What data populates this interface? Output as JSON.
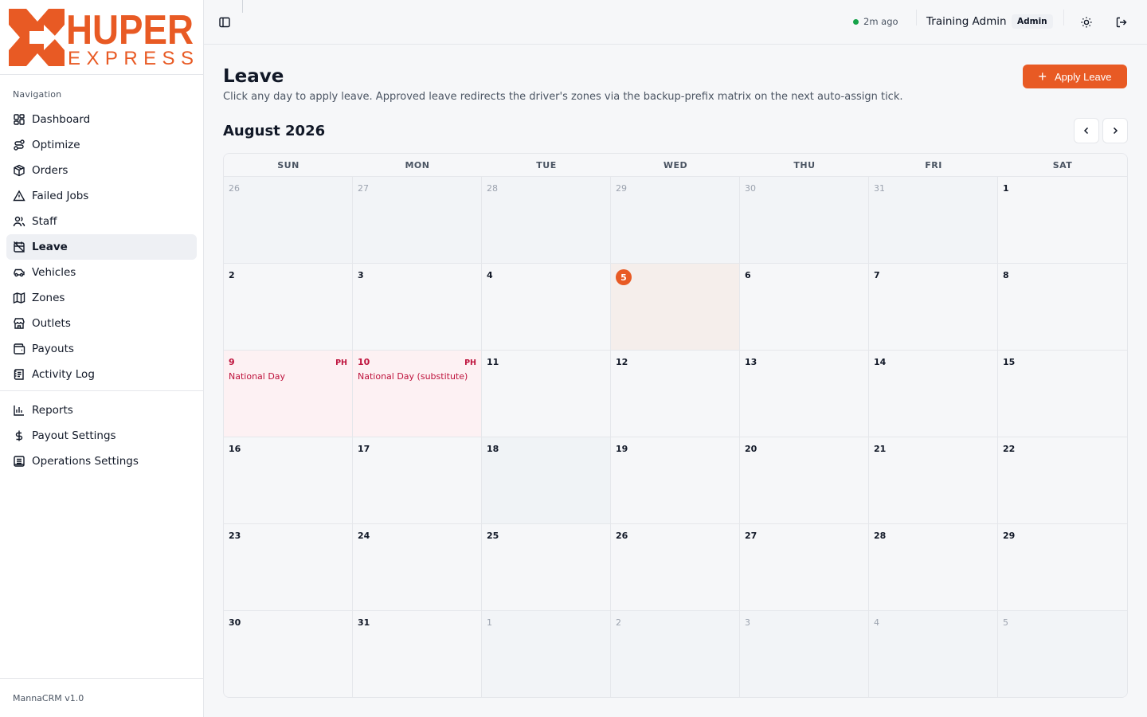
{
  "brand": {
    "logo_top": "HUPER",
    "logo_bottom": "EXPRESS",
    "accent_color": "#e85a24"
  },
  "sidebar": {
    "heading": "Navigation",
    "items": [
      {
        "label": "Dashboard",
        "icon": "layout-grid-icon"
      },
      {
        "label": "Optimize",
        "icon": "route-icon"
      },
      {
        "label": "Orders",
        "icon": "package-icon"
      },
      {
        "label": "Failed Jobs",
        "icon": "alert-triangle-icon"
      },
      {
        "label": "Staff",
        "icon": "users-icon"
      },
      {
        "label": "Leave",
        "icon": "calendar-off-icon",
        "active": true
      },
      {
        "label": "Vehicles",
        "icon": "car-icon"
      },
      {
        "label": "Zones",
        "icon": "map-icon"
      },
      {
        "label": "Outlets",
        "icon": "store-icon"
      },
      {
        "label": "Payouts",
        "icon": "wallet-icon"
      },
      {
        "label": "Activity Log",
        "icon": "log-icon"
      }
    ],
    "items2": [
      {
        "label": "Reports",
        "icon": "bar-chart-icon"
      },
      {
        "label": "Payout Settings",
        "icon": "dollar-icon"
      },
      {
        "label": "Operations Settings",
        "icon": "settings-icon"
      }
    ],
    "footer": "MannaCRM v1.0"
  },
  "topbar": {
    "status_text": "2m ago",
    "status_color": "#16a34a",
    "user_name": "Training Admin",
    "role": "Admin"
  },
  "page": {
    "title": "Leave",
    "description": "Click any day to apply leave. Approved leave redirects the driver's zones via the backup-prefix matrix on the next auto-assign tick.",
    "apply_button": "Apply Leave",
    "apply_icon": "+"
  },
  "calendar": {
    "month_label": "August 2026",
    "weekdays": [
      "SUN",
      "MON",
      "TUE",
      "WED",
      "THU",
      "FRI",
      "SAT"
    ],
    "days": [
      {
        "n": "26",
        "muted": true
      },
      {
        "n": "27",
        "muted": true
      },
      {
        "n": "28",
        "muted": true
      },
      {
        "n": "29",
        "muted": true
      },
      {
        "n": "30",
        "muted": true
      },
      {
        "n": "31",
        "muted": true
      },
      {
        "n": "1"
      },
      {
        "n": "2"
      },
      {
        "n": "3"
      },
      {
        "n": "4"
      },
      {
        "n": "5",
        "today": true
      },
      {
        "n": "6"
      },
      {
        "n": "7"
      },
      {
        "n": "8"
      },
      {
        "n": "9",
        "holiday": "National Day",
        "tag": "PH"
      },
      {
        "n": "10",
        "holiday": "National Day (substitute)",
        "tag": "PH"
      },
      {
        "n": "11"
      },
      {
        "n": "12"
      },
      {
        "n": "13"
      },
      {
        "n": "14"
      },
      {
        "n": "15"
      },
      {
        "n": "16"
      },
      {
        "n": "17"
      },
      {
        "n": "18",
        "hover": true
      },
      {
        "n": "19"
      },
      {
        "n": "20"
      },
      {
        "n": "21"
      },
      {
        "n": "22"
      },
      {
        "n": "23"
      },
      {
        "n": "24"
      },
      {
        "n": "25"
      },
      {
        "n": "26"
      },
      {
        "n": "27"
      },
      {
        "n": "28"
      },
      {
        "n": "29"
      },
      {
        "n": "30"
      },
      {
        "n": "31"
      },
      {
        "n": "1",
        "muted": true
      },
      {
        "n": "2",
        "muted": true
      },
      {
        "n": "3",
        "muted": true
      },
      {
        "n": "4",
        "muted": true
      },
      {
        "n": "5",
        "muted": true
      }
    ]
  }
}
